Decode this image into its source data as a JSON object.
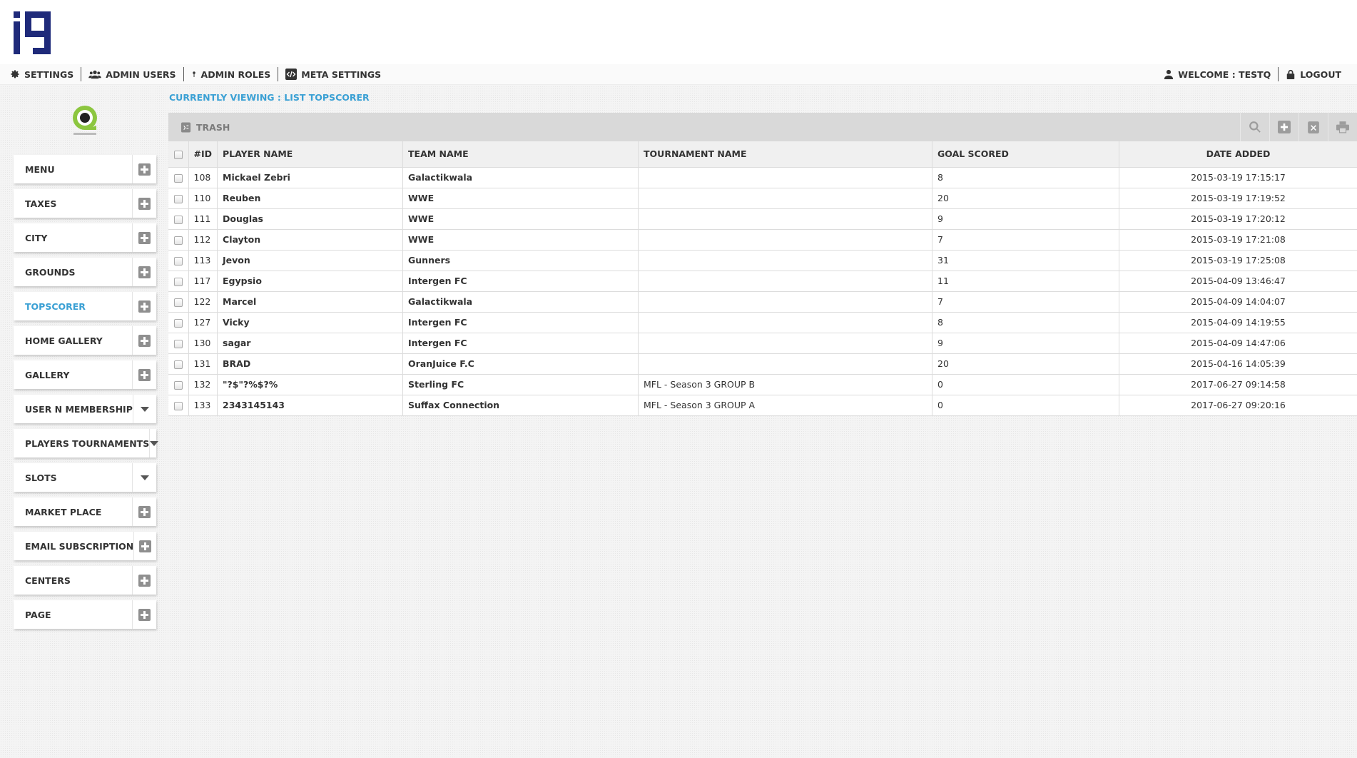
{
  "colors": {
    "accent": "#3aa0d4",
    "logo": "#1f2a7a",
    "brand_green": "#8cc63f"
  },
  "nav": {
    "left": [
      {
        "label": "SETTINGS",
        "icon": "gear-icon"
      },
      {
        "label": "ADMIN USERS",
        "icon": "users-icon"
      },
      {
        "label": "ADMIN ROLES",
        "icon": "pin-icon"
      },
      {
        "label": "META SETTINGS",
        "icon": "code-icon"
      }
    ],
    "right": [
      {
        "label": "WELCOME : TESTQ",
        "icon": "user-icon"
      },
      {
        "label": "LOGOUT",
        "icon": "lock-icon"
      }
    ]
  },
  "sidebar": {
    "items": [
      {
        "label": "MENU",
        "action": "plus"
      },
      {
        "label": "TAXES",
        "action": "plus"
      },
      {
        "label": "CITY",
        "action": "plus"
      },
      {
        "label": "GROUNDS",
        "action": "plus"
      },
      {
        "label": "TOPSCORER",
        "action": "plus",
        "active": true
      },
      {
        "label": "HOME GALLERY",
        "action": "plus"
      },
      {
        "label": "GALLERY",
        "action": "plus"
      },
      {
        "label": "USER N MEMBERSHIP",
        "action": "caret"
      },
      {
        "label": "PLAYERS TOURNAMENTS",
        "action": "caret"
      },
      {
        "label": "SLOTS",
        "action": "caret"
      },
      {
        "label": "MARKET PLACE",
        "action": "plus"
      },
      {
        "label": "EMAIL SUBSCRIPTION",
        "action": "plus"
      },
      {
        "label": "CENTERS",
        "action": "plus"
      },
      {
        "label": "PAGE",
        "action": "plus"
      }
    ]
  },
  "main": {
    "breadcrumb": "CURRENTLY VIEWING : LIST TOPSCORER",
    "toolbar": {
      "trash_label": "TRASH",
      "tools": [
        "search-icon",
        "add-icon",
        "delete-icon",
        "print-icon"
      ]
    },
    "table": {
      "columns": [
        "#ID",
        "PLAYER NAME",
        "TEAM NAME",
        "TOURNAMENT NAME",
        "GOAL SCORED",
        "DATE ADDED"
      ],
      "rows": [
        [
          "108",
          "Mickael Zebri",
          "Galactikwala",
          "",
          "8",
          "2015-03-19 17:15:17"
        ],
        [
          "110",
          "Reuben",
          "WWE",
          "",
          "20",
          "2015-03-19 17:19:52"
        ],
        [
          "111",
          "Douglas",
          "WWE",
          "",
          "9",
          "2015-03-19 17:20:12"
        ],
        [
          "112",
          "Clayton",
          "WWE",
          "",
          "7",
          "2015-03-19 17:21:08"
        ],
        [
          "113",
          "Jevon",
          "Gunners",
          "",
          "31",
          "2015-03-19 17:25:08"
        ],
        [
          "117",
          "Egypsio",
          "Intergen FC",
          "",
          "11",
          "2015-04-09 13:46:47"
        ],
        [
          "122",
          "Marcel",
          "Galactikwala",
          "",
          "7",
          "2015-04-09 14:04:07"
        ],
        [
          "127",
          "Vicky",
          "Intergen FC",
          "",
          "8",
          "2015-04-09 14:19:55"
        ],
        [
          "130",
          "sagar",
          "Intergen FC",
          "",
          "9",
          "2015-04-09 14:47:06"
        ],
        [
          "131",
          "BRAD",
          "OranJuice F.C",
          "",
          "20",
          "2015-04-16 14:05:39"
        ],
        [
          "132",
          "\"?$\"?%$?%",
          "Sterling FC",
          "MFL - Season 3 GROUP B",
          "0",
          "2017-06-27 09:14:58"
        ],
        [
          "133",
          "2343145143",
          "Suffax Connection",
          "MFL - Season 3 GROUP A",
          "0",
          "2017-06-27 09:20:16"
        ]
      ]
    }
  }
}
